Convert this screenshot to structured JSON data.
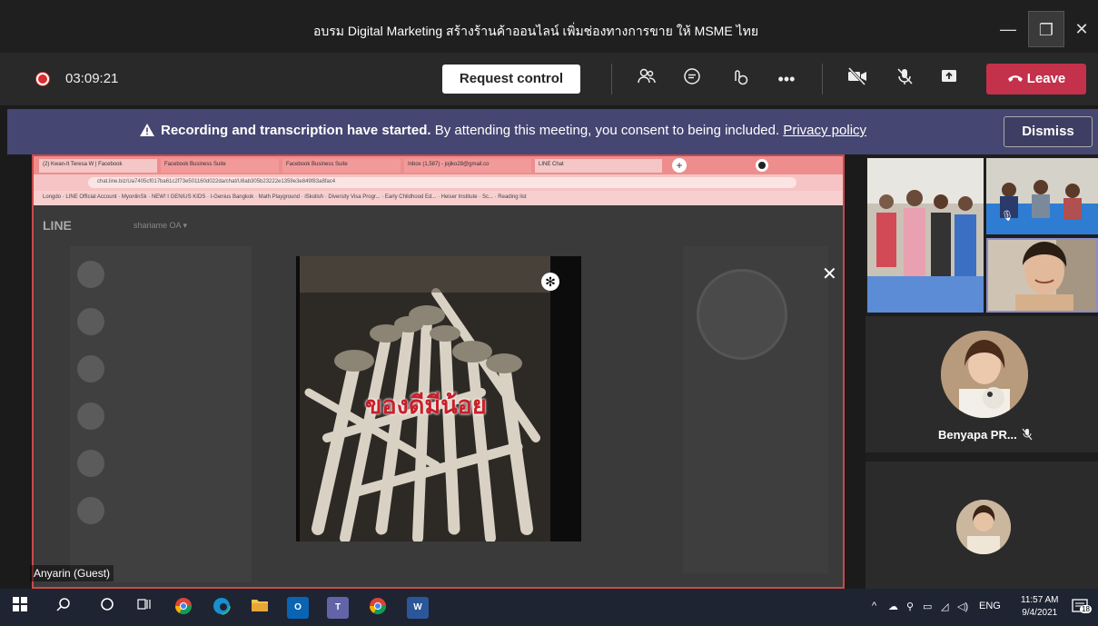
{
  "window": {
    "title": "อบรม Digital Marketing สร้างร้านค้าออนไลน์ เพิ่มช่องทางการขาย ให้ MSME ไทย",
    "minimize": "—",
    "maximize": "❐",
    "close": "✕"
  },
  "toolbar": {
    "timer": "03:09:21",
    "request_control": "Request control",
    "leave": "Leave"
  },
  "banner": {
    "bold_text": "Recording and transcription have started.",
    "text": " By attending this meeting, you consent to being included. ",
    "link": "Privacy policy",
    "dismiss": "Dismiss"
  },
  "shared_screen": {
    "browser_tabs": [
      "(2) Kwan-It Teresa W | Facebook",
      "Facebook Business Suite",
      "Facebook Business Suite",
      "Inbox (1,587) - jojiko28@gmail.co",
      "LINE Chat"
    ],
    "url": "chat.line.biz/Ua7405cf017ba61c2f73e501160d022da/chat/U8ab305b23222e1359e3e849f83a8fac4",
    "bookmarks": "Longdo · LINE Official Account · MyonlinSk · NEW! I GENIUS KIDS · I-Genius Bangkok · Math Playground · iSkolish · Diversity Visa Progr... · Early Childhood Ed... · Heiser Institute · Sc... · Reading list",
    "line_logo": "LINE",
    "account": "shariame OA ▾",
    "caption": "ของดีมีน้อย",
    "presenter": "Anyarin (Guest)"
  },
  "participants": {
    "featured_name": "Benyapa PR..."
  },
  "taskbar": {
    "lang": "ENG",
    "time": "11:57 AM",
    "date": "9/4/2021",
    "notif_count": "18"
  },
  "colors": {
    "leave": "#c4314b",
    "banner": "#454671",
    "recording": "#d92c2c",
    "caption": "#c8202a"
  }
}
